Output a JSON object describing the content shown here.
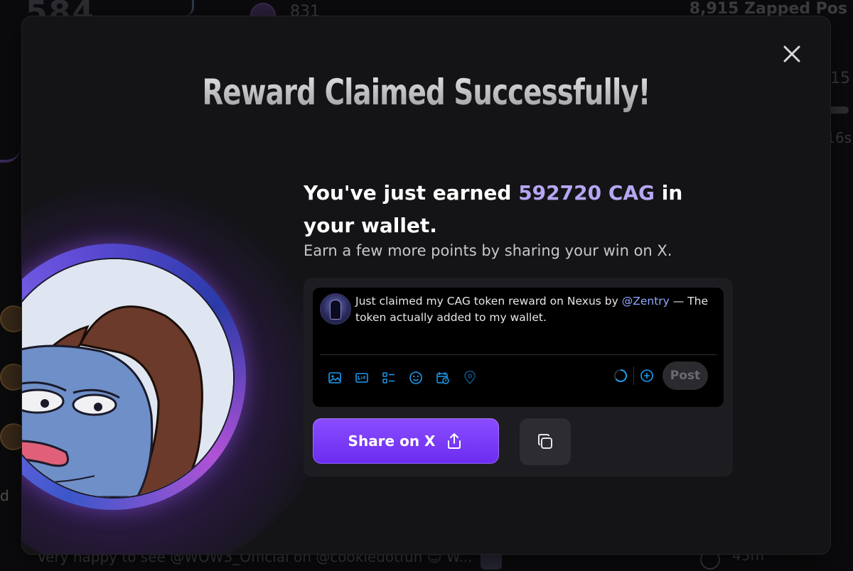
{
  "background": {
    "stat_left": "584",
    "stat_mid": "831",
    "stat_right": "8,915 Zapped Pos",
    "fraction": "/15",
    "seconds": "16s",
    "row_letter": "d",
    "footer_text": "Very happy to see @WOW3_Official on @cookiedotfun 😊 W...",
    "footer_time": "45m"
  },
  "modal": {
    "title": "Reward Claimed Successfully!",
    "headline_prefix": "You've just earned ",
    "headline_amount": "592720 CAG",
    "headline_suffix": " in your wallet.",
    "subtext": "Earn a few more points by sharing your win on X.",
    "tweet": {
      "text_prefix": "Just claimed my CAG token reward on Nexus by ",
      "mention": "@Zentry",
      "text_suffix": " — The token actually added to my wallet.",
      "post_label": "Post",
      "tools": [
        "image-icon",
        "gif-icon",
        "poll-icon",
        "emoji-icon",
        "schedule-icon",
        "location-icon"
      ]
    },
    "share_label": "Share on X",
    "colors": {
      "accent": "#b7a6f3",
      "button": "#7a3cff",
      "mention": "#8fa8ff"
    }
  }
}
